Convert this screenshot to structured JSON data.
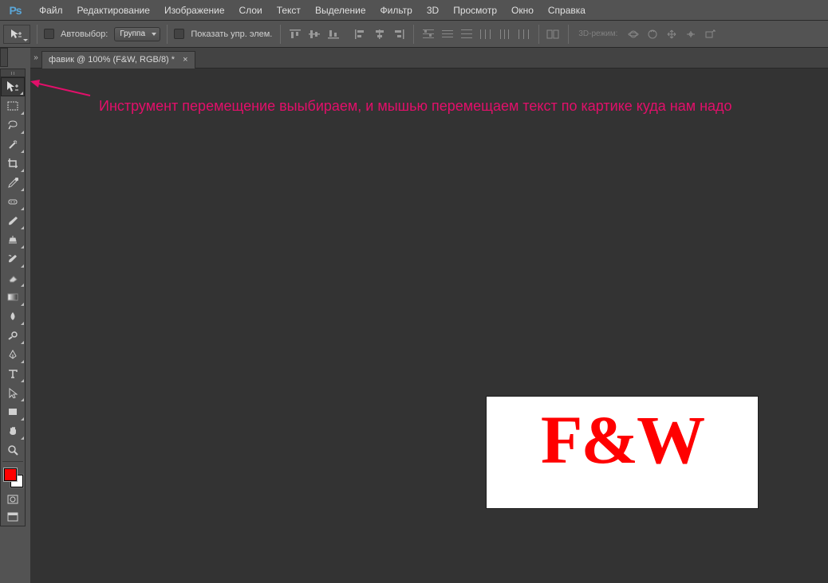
{
  "menu": {
    "items": [
      "Файл",
      "Редактирование",
      "Изображение",
      "Слои",
      "Текст",
      "Выделение",
      "Фильтр",
      "3D",
      "Просмотр",
      "Окно",
      "Справка"
    ]
  },
  "options": {
    "auto_select_label": "Автовыбор:",
    "group_label": "Группа",
    "show_controls_label": "Показать упр. элем.",
    "mode3d_label": "3D-режим:"
  },
  "tools": [
    {
      "name": "move-tool",
      "selected": true
    },
    {
      "name": "marquee-tool"
    },
    {
      "name": "lasso-tool"
    },
    {
      "name": "magic-wand-tool"
    },
    {
      "name": "crop-tool"
    },
    {
      "name": "eyedropper-tool"
    },
    {
      "name": "healing-brush-tool"
    },
    {
      "name": "brush-tool"
    },
    {
      "name": "clone-stamp-tool"
    },
    {
      "name": "history-brush-tool"
    },
    {
      "name": "eraser-tool"
    },
    {
      "name": "gradient-tool"
    },
    {
      "name": "blur-tool"
    },
    {
      "name": "dodge-tool"
    },
    {
      "name": "pen-tool"
    },
    {
      "name": "type-tool"
    },
    {
      "name": "path-select-tool"
    },
    {
      "name": "rectangle-tool"
    },
    {
      "name": "hand-tool"
    },
    {
      "name": "zoom-tool"
    }
  ],
  "tab": {
    "title": "фавик @ 100% (F&W, RGB/8) *"
  },
  "annotation": {
    "text": "Инструмент перемещение выыбираем, и мышью перемещаем текст по картике куда нам надо"
  },
  "artwork": {
    "text": "F&W"
  }
}
